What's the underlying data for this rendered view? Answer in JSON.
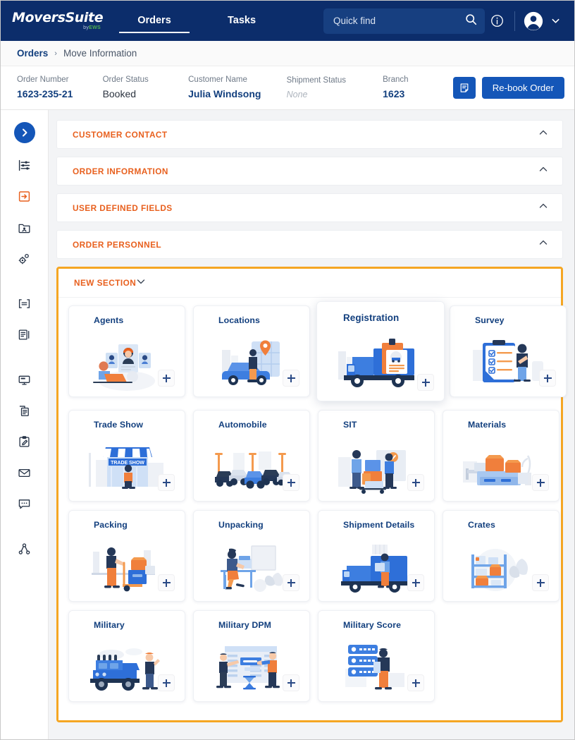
{
  "app": {
    "logo_main": "MoversSuite",
    "logo_by": "by",
    "logo_brand": "EWS"
  },
  "topnav": {
    "tabs": [
      {
        "label": "Orders",
        "active": true
      },
      {
        "label": "Tasks",
        "active": false
      }
    ],
    "search": {
      "value": "",
      "placeholder": "Quick find"
    },
    "icons": [
      "search-icon",
      "info-icon",
      "avatar-icon",
      "chevron-down-icon"
    ],
    "colors": {
      "bg": "#0c2d6b",
      "search_bg": "#173f80"
    }
  },
  "breadcrumb": {
    "root": "Orders",
    "separator": "›",
    "current": "Move Information"
  },
  "orderbar": {
    "fields": [
      {
        "label": "Order Number",
        "value": "1623-235-21",
        "style": "bold"
      },
      {
        "label": "Order Status",
        "value": "Booked",
        "style": "plain"
      },
      {
        "label": "Customer Name",
        "value": "Julia Windsong",
        "style": "bold"
      },
      {
        "label": "Shipment Status",
        "value": "None",
        "style": "none"
      },
      {
        "label": "Branch",
        "value": "1623",
        "style": "bold"
      }
    ],
    "note_icon": "note-icon",
    "rebook_label": "Re-book Order",
    "button_color": "#1456b8"
  },
  "sidebar": {
    "toggle": "chevron-right-icon",
    "items": [
      {
        "name": "filters-icon",
        "active": false
      },
      {
        "name": "order-card-icon",
        "active": true
      },
      {
        "name": "contact-folder-icon",
        "active": false
      },
      {
        "name": "settings-gears-icon",
        "active": false
      },
      {
        "name": "text-block-icon",
        "active": false
      },
      {
        "name": "document-panel-icon",
        "active": false
      },
      {
        "name": "monitor-icon",
        "active": false
      },
      {
        "name": "copy-document-icon",
        "active": false
      },
      {
        "name": "edit-clipboard-icon",
        "active": false
      },
      {
        "name": "envelope-icon",
        "active": false
      },
      {
        "name": "chat-bubble-icon",
        "active": false
      },
      {
        "name": "share-nodes-icon",
        "active": false
      }
    ]
  },
  "accordions": [
    {
      "title": "CUSTOMER CONTACT",
      "expanded": false,
      "chevron": "chevron-up-icon"
    },
    {
      "title": "ORDER INFORMATION",
      "expanded": false,
      "chevron": "chevron-up-icon"
    },
    {
      "title": "USER DEFINED FIELDS",
      "expanded": false,
      "chevron": "chevron-up-icon"
    },
    {
      "title": "ORDER PERSONNEL",
      "expanded": false,
      "chevron": "chevron-up-icon"
    }
  ],
  "new_section": {
    "title": "NEW SECTION",
    "expanded": true,
    "chevron": "chevron-down-icon",
    "highlight_color": "#f5a623",
    "title_color": "#e8601e",
    "cards": [
      [
        {
          "title": "Agents",
          "art": "agents",
          "featured": false,
          "add": "+"
        },
        {
          "title": "Locations",
          "art": "locations",
          "featured": false,
          "add": "+"
        },
        {
          "title": "Registration",
          "art": "truckreg",
          "featured": true,
          "add": "+"
        },
        {
          "title": "Survey",
          "art": "survey",
          "featured": false,
          "add": "+"
        }
      ],
      [
        {
          "title": "Trade Show",
          "art": "tradeshow",
          "featured": false,
          "add": "+"
        },
        {
          "title": "Automobile",
          "art": "autos",
          "featured": false,
          "add": "+"
        },
        {
          "title": "SIT",
          "art": "sit",
          "featured": false,
          "add": "+"
        },
        {
          "title": "Materials",
          "art": "materials",
          "featured": false,
          "add": "+"
        }
      ],
      [
        {
          "title": "Packing",
          "art": "packing",
          "featured": false,
          "add": "+"
        },
        {
          "title": "Unpacking",
          "art": "unpacking",
          "featured": false,
          "add": "+"
        },
        {
          "title": "Shipment Details",
          "art": "shipment",
          "featured": false,
          "add": "+"
        },
        {
          "title": "Crates",
          "art": "crates",
          "featured": false,
          "add": "+"
        }
      ],
      [
        {
          "title": "Military",
          "art": "military",
          "featured": false,
          "add": "+"
        },
        {
          "title": "Military DPM",
          "art": "dpm",
          "featured": false,
          "add": "+"
        },
        {
          "title": "Military Score",
          "art": "score",
          "featured": false,
          "add": "+"
        }
      ]
    ]
  },
  "palette": {
    "navy": "#0c2d6b",
    "blue": "#1456b8",
    "orange": "#e8601e",
    "amber": "#f5a623",
    "card_title": "#123f7e"
  }
}
